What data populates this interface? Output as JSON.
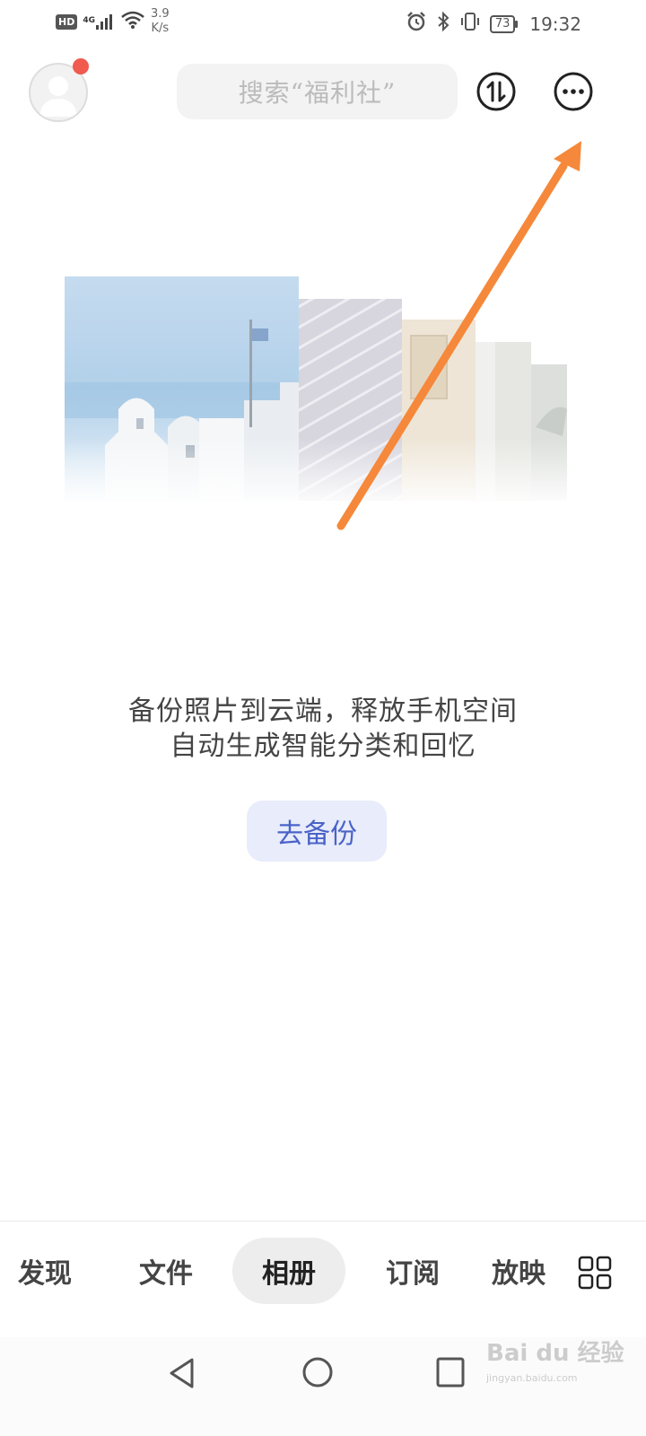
{
  "status_bar": {
    "hd": "HD",
    "network": "4G",
    "speed_value": "3.9",
    "speed_unit": "K/s",
    "battery": "73",
    "time": "19:32"
  },
  "header": {
    "search_placeholder": "搜索“福利社”"
  },
  "main": {
    "tagline_line1": "备份照片到云端，释放手机空间",
    "tagline_line2": "自动生成智能分类和回忆",
    "backup_button": "去备份"
  },
  "tabs": [
    {
      "label": "发现",
      "active": false
    },
    {
      "label": "文件",
      "active": false
    },
    {
      "label": "相册",
      "active": true
    },
    {
      "label": "订阅",
      "active": false
    },
    {
      "label": "放映",
      "active": false
    }
  ],
  "watermark": {
    "text": "Bai du 经验",
    "sub": "jingyan.baidu.com"
  },
  "colors": {
    "accent": "#4a63c8",
    "button_bg": "#e8ecfb",
    "notification": "#f05a4f",
    "annotation_arrow": "#f5883a"
  }
}
